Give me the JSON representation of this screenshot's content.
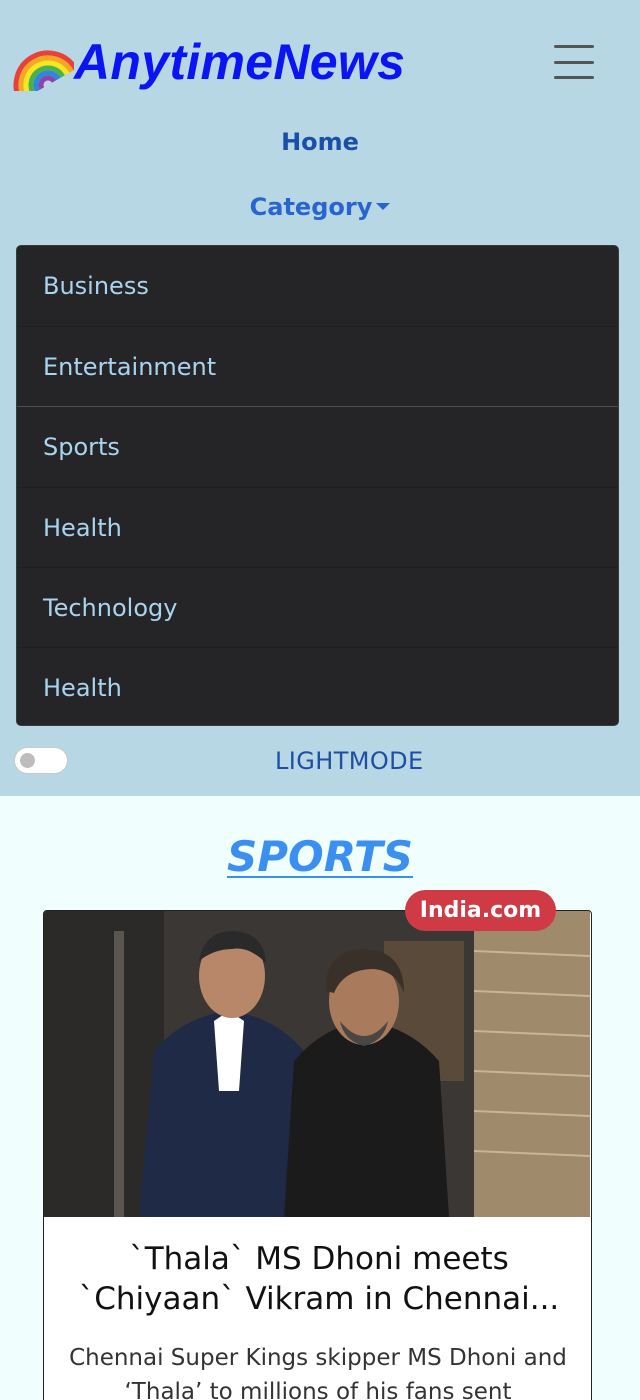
{
  "brand": {
    "name": "AnytimeNews"
  },
  "nav": {
    "home": "Home",
    "category": "Category",
    "dropdown_items": [
      "Business",
      "Entertainment",
      "Sports",
      "Health",
      "Technology",
      "Health"
    ]
  },
  "theme_toggle": {
    "label": "LIGHTMODE"
  },
  "section": {
    "title": "SPORTS"
  },
  "article": {
    "source": "India.com",
    "title": "`Thala` MS Dhoni meets `Chiyaan` Vikram in Chennai...",
    "description": "Chennai Super Kings skipper MS Dhoni and ‘Thala’ to millions of his fans sent"
  },
  "colors": {
    "navbar_bg": "#b6d7e3",
    "brand": "#0a14f5",
    "dropdown_bg": "#252527",
    "dropdown_text": "#a8d4ef",
    "section_title": "#3a8ff0",
    "badge_bg": "#d03a44",
    "page_bg": "#f0fffe"
  }
}
